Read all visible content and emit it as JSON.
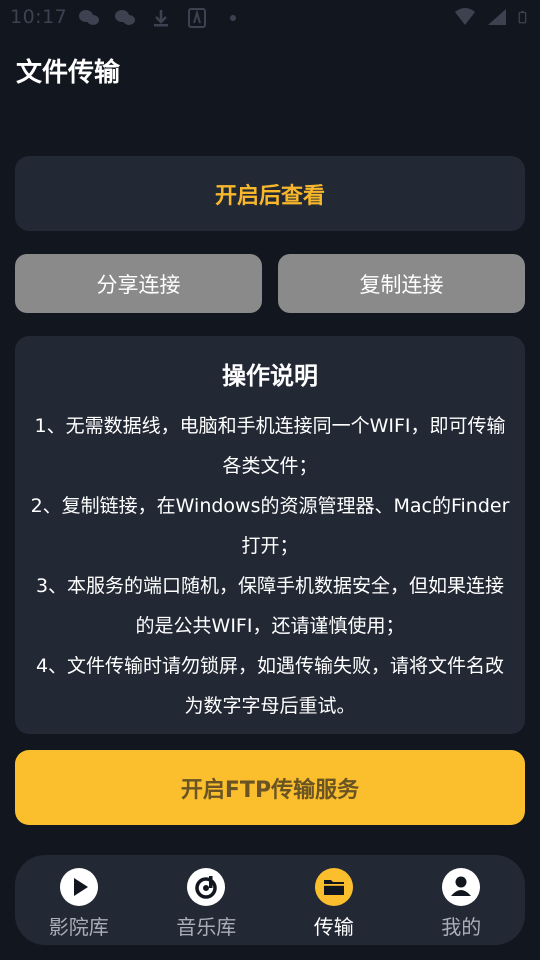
{
  "status_bar": {
    "time": "10:17"
  },
  "header": {
    "title": "文件传输"
  },
  "view_card": {
    "label": "开启后查看"
  },
  "actions": {
    "share_label": "分享连接",
    "copy_label": "复制连接"
  },
  "instructions": {
    "title": "操作说明",
    "lines": [
      "1、无需数据线，电脑和手机连接同一个WIFI，即可传输各类文件；",
      "2、复制链接，在Windows的资源管理器、Mac的Finder打开；",
      "3、本服务的端口随机，保障手机数据安全，但如果连接的是公共WIFI，还请谨慎使用；",
      "4、文件传输时请勿锁屏，如遇传输失败，请将文件名改为数字字母后重试。"
    ]
  },
  "ftp_button": {
    "label": "开启FTP传输服务"
  },
  "tabs": [
    {
      "label": "影院库",
      "icon": "play-icon",
      "active": false
    },
    {
      "label": "音乐库",
      "icon": "music-icon",
      "active": false
    },
    {
      "label": "传输",
      "icon": "folder-icon",
      "active": true
    },
    {
      "label": "我的",
      "icon": "user-icon",
      "active": false
    }
  ],
  "colors": {
    "background": "#12161f",
    "card": "#232835",
    "accent": "#fbbf2e",
    "accent_text": "#f8b72b",
    "grey_button": "#8a8a8a"
  }
}
